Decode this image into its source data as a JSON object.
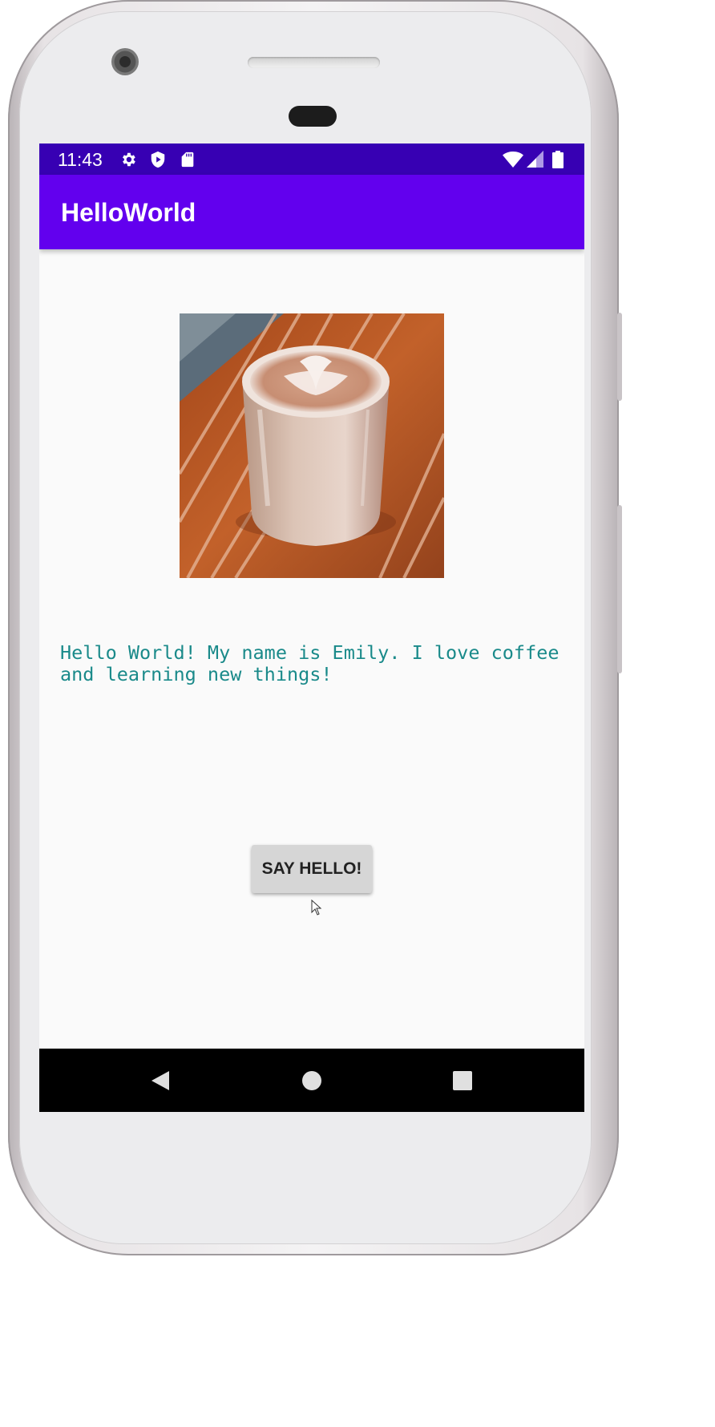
{
  "status_bar": {
    "time": "11:43",
    "left_icons": [
      "gear-icon",
      "shield-play-icon",
      "sd-card-icon"
    ],
    "right_icons": [
      "wifi-icon",
      "cell-signal-icon",
      "battery-icon"
    ]
  },
  "app_bar": {
    "title": "HelloWorld"
  },
  "main": {
    "image_subject": "latte-art-coffee-glass",
    "intro_text": "Hello World! My name is Emily. I love coffee\nand learning new things!",
    "button_label": "SAY HELLO!"
  },
  "nav_bar": {
    "buttons": [
      "back-icon",
      "home-icon",
      "recents-icon"
    ]
  },
  "colors": {
    "status_bar": "#3700b3",
    "app_bar": "#6200ee",
    "intro_text": "#1a8a8a",
    "button": "#d6d6d6",
    "background": "#fafafa"
  }
}
